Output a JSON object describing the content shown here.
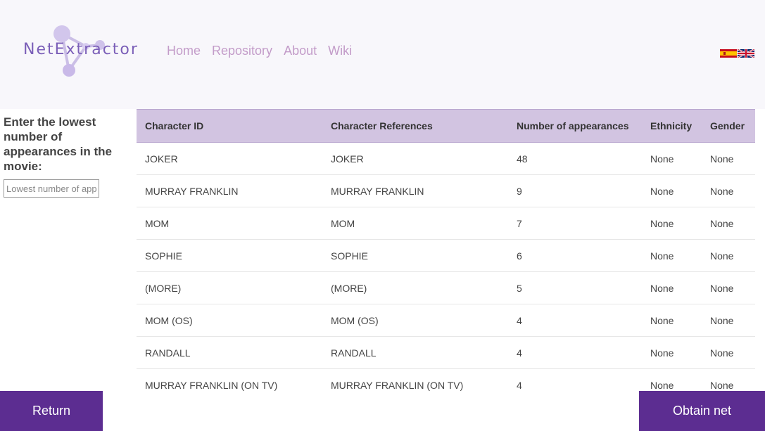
{
  "brand": {
    "name": "NetExtractor"
  },
  "nav": {
    "items": [
      {
        "label": "Home"
      },
      {
        "label": "Repository"
      },
      {
        "label": "About"
      },
      {
        "label": "Wiki"
      }
    ]
  },
  "languages": [
    {
      "icon": "spain-flag-icon"
    },
    {
      "icon": "uk-flag-icon"
    }
  ],
  "sidebar": {
    "label": "Enter the lowest number of appearances in the movie:",
    "input_placeholder": "Lowest number of appearances",
    "input_value": ""
  },
  "table": {
    "columns": [
      "Character ID",
      "Character References",
      "Number of appearances",
      "Ethnicity",
      "Gender"
    ],
    "rows": [
      [
        "JOKER",
        "JOKER",
        "48",
        "None",
        "None"
      ],
      [
        "MURRAY FRANKLIN",
        "MURRAY FRANKLIN",
        "9",
        "None",
        "None"
      ],
      [
        "MOM",
        "MOM",
        "7",
        "None",
        "None"
      ],
      [
        "SOPHIE",
        "SOPHIE",
        "6",
        "None",
        "None"
      ],
      [
        "(MORE)",
        "(MORE)",
        "5",
        "None",
        "None"
      ],
      [
        "MOM (OS)",
        "MOM (OS)",
        "4",
        "None",
        "None"
      ],
      [
        "RANDALL",
        "RANDALL",
        "4",
        "None",
        "None"
      ],
      [
        "MURRAY FRANKLIN (ON TV)",
        "MURRAY FRANKLIN (ON TV)",
        "4",
        "None",
        "None"
      ]
    ]
  },
  "buttons": {
    "return_label": "Return",
    "obtain_label": "Obtain net"
  },
  "colors": {
    "accent": "#5c2d91",
    "header_bg": "#f8f7fb",
    "table_header_bg": "#d2c4e1",
    "nav_link": "#c39cc9"
  }
}
